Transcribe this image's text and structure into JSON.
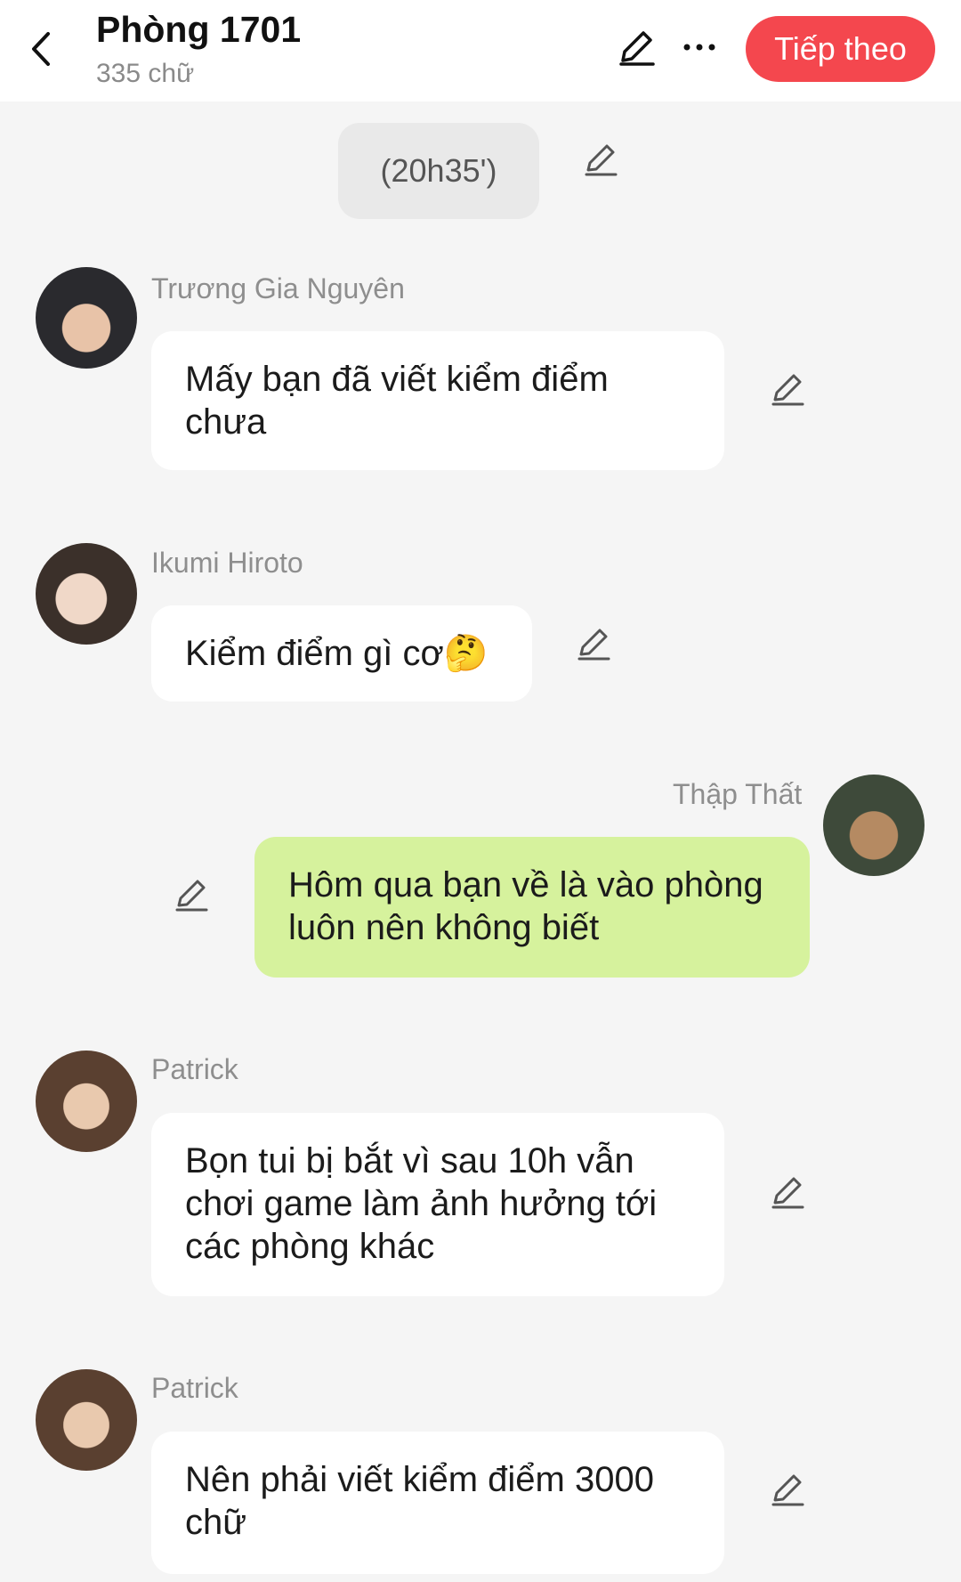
{
  "header": {
    "title": "Phòng 1701",
    "subtitle": "335 chữ",
    "next_label": "Tiếp theo"
  },
  "timestamp": "(20h35')",
  "colors": {
    "accent": "#f4474e",
    "my_bubble": "#d6f29d",
    "other_bubble": "#ffffff",
    "background": "#f5f5f5"
  },
  "messages": [
    {
      "sender": "Trương Gia Nguyên",
      "text": "Mấy bạn đã viết kiểm điểm chưa",
      "side": "left"
    },
    {
      "sender": "Ikumi Hiroto",
      "text": "Kiểm điểm gì cơ",
      "emoji": "🤔",
      "side": "left"
    },
    {
      "sender": "Thập Thất",
      "text": "Hôm qua bạn về là vào phòng luôn nên không biết",
      "side": "right"
    },
    {
      "sender": "Patrick",
      "text": "Bọn tui bị bắt vì sau 10h vẫn chơi game làm ảnh hưởng tới các phòng khác",
      "side": "left"
    },
    {
      "sender": "Patrick",
      "text": "Nên phải viết kiểm điểm 3000 chữ",
      "side": "left"
    }
  ],
  "icons": {
    "back": "chevron-left-icon",
    "edit": "pencil-icon",
    "more": "ellipsis-icon"
  }
}
